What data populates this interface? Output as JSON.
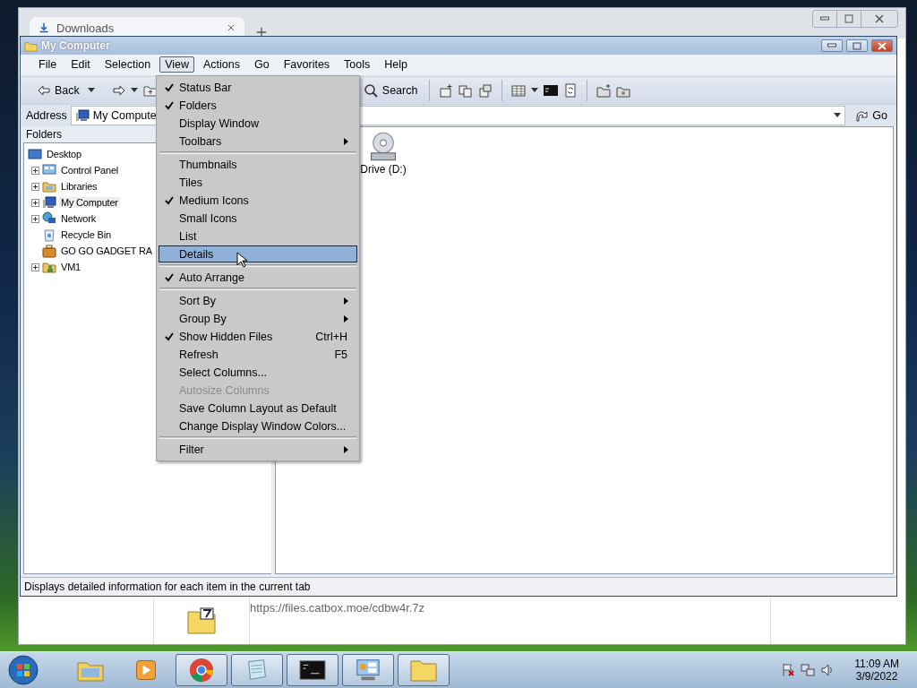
{
  "browser": {
    "tab": {
      "title": "Downloads"
    },
    "download": {
      "url": "https://files.catbox.moe/cdbw4r.7z"
    }
  },
  "window": {
    "title": "My Computer"
  },
  "menu_bar": [
    {
      "label": "File",
      "selected": false
    },
    {
      "label": "Edit",
      "selected": false
    },
    {
      "label": "Selection",
      "selected": false
    },
    {
      "label": "View",
      "selected": true
    },
    {
      "label": "Actions",
      "selected": false
    },
    {
      "label": "Go",
      "selected": false
    },
    {
      "label": "Favorites",
      "selected": false
    },
    {
      "label": "Tools",
      "selected": false
    },
    {
      "label": "Help",
      "selected": false
    }
  ],
  "toolbar": {
    "back": "Back",
    "search": "Search"
  },
  "address_bar": {
    "label": "Address",
    "value": "My Compute",
    "go": "Go"
  },
  "folders_pane": {
    "title": "Folders",
    "tree": [
      {
        "label": "Desktop",
        "kind": "desktop",
        "selected": false,
        "children": [
          {
            "label": "Control Panel",
            "kind": "control-panel",
            "expandable": true,
            "selected": false
          },
          {
            "label": "Libraries",
            "kind": "libraries",
            "expandable": true,
            "selected": false
          },
          {
            "label": "My Computer",
            "kind": "computer",
            "expandable": true,
            "selected": true
          },
          {
            "label": "Network",
            "kind": "network",
            "expandable": true,
            "selected": false
          },
          {
            "label": "Recycle Bin",
            "kind": "recycle-bin",
            "expandable": false,
            "selected": false
          },
          {
            "label": "GO GO GADGET RA",
            "kind": "briefcase",
            "expandable": false,
            "selected": false
          },
          {
            "label": "VM1",
            "kind": "user",
            "expandable": true,
            "selected": false
          }
        ]
      }
    ]
  },
  "content": {
    "items": [
      {
        "label": "Drive (D:)"
      }
    ]
  },
  "view_menu": {
    "items": [
      {
        "kind": "item",
        "label": "Status Bar",
        "checked": true,
        "submenu": false,
        "selected": false,
        "disabled": false
      },
      {
        "kind": "item",
        "label": "Folders",
        "checked": true,
        "submenu": false,
        "selected": false,
        "disabled": false
      },
      {
        "kind": "item",
        "label": "Display Window",
        "checked": false,
        "submenu": false,
        "selected": false,
        "disabled": false
      },
      {
        "kind": "item",
        "label": "Toolbars",
        "checked": false,
        "submenu": true,
        "selected": false,
        "disabled": false
      },
      {
        "kind": "separator"
      },
      {
        "kind": "item",
        "label": "Thumbnails",
        "checked": false,
        "submenu": false,
        "selected": false,
        "disabled": false
      },
      {
        "kind": "item",
        "label": "Tiles",
        "checked": false,
        "submenu": false,
        "selected": false,
        "disabled": false
      },
      {
        "kind": "item",
        "label": "Medium Icons",
        "checked": true,
        "submenu": false,
        "selected": false,
        "disabled": false
      },
      {
        "kind": "item",
        "label": "Small Icons",
        "checked": false,
        "submenu": false,
        "selected": false,
        "disabled": false
      },
      {
        "kind": "item",
        "label": "List",
        "checked": false,
        "submenu": false,
        "selected": false,
        "disabled": false
      },
      {
        "kind": "item",
        "label": "Details",
        "checked": false,
        "submenu": false,
        "selected": true,
        "disabled": false
      },
      {
        "kind": "separator"
      },
      {
        "kind": "item",
        "label": "Auto Arrange",
        "checked": true,
        "submenu": false,
        "selected": false,
        "disabled": false
      },
      {
        "kind": "separator"
      },
      {
        "kind": "item",
        "label": "Sort By",
        "checked": false,
        "submenu": true,
        "selected": false,
        "disabled": false
      },
      {
        "kind": "item",
        "label": "Group By",
        "checked": false,
        "submenu": true,
        "selected": false,
        "disabled": false
      },
      {
        "kind": "item",
        "label": "Show Hidden Files",
        "checked": true,
        "submenu": false,
        "selected": false,
        "disabled": false,
        "shortcut": "Ctrl+H"
      },
      {
        "kind": "item",
        "label": "Refresh",
        "checked": false,
        "submenu": false,
        "selected": false,
        "disabled": false,
        "shortcut": "F5"
      },
      {
        "kind": "item",
        "label": "Select Columns...",
        "checked": false,
        "submenu": false,
        "selected": false,
        "disabled": false
      },
      {
        "kind": "item",
        "label": "Autosize Columns",
        "checked": false,
        "submenu": false,
        "selected": false,
        "disabled": true
      },
      {
        "kind": "item",
        "label": "Save Column Layout as Default",
        "checked": false,
        "submenu": false,
        "selected": false,
        "disabled": false
      },
      {
        "kind": "item",
        "label": "Change Display Window Colors...",
        "checked": false,
        "submenu": false,
        "selected": false,
        "disabled": false
      },
      {
        "kind": "separator"
      },
      {
        "kind": "item",
        "label": "Filter",
        "checked": false,
        "submenu": true,
        "selected": false,
        "disabled": false
      }
    ]
  },
  "status_bar": {
    "text": "Displays detailed information for each item in the current tab"
  },
  "taskbar": {
    "buttons": [
      {
        "kind": "explorer",
        "open": false
      },
      {
        "kind": "media",
        "open": false
      },
      {
        "kind": "chrome",
        "open": true
      },
      {
        "kind": "notepad",
        "open": true
      },
      {
        "kind": "console",
        "open": true
      },
      {
        "kind": "control-panel",
        "open": true
      },
      {
        "kind": "folder",
        "open": true
      }
    ],
    "clock": {
      "time": "11:09 AM",
      "date": "3/9/2022"
    }
  }
}
